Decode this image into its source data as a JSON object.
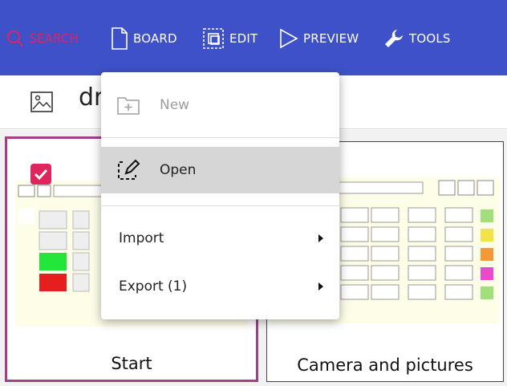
{
  "toolbar": {
    "search_label": "SEARCH",
    "board_label": "BOARD",
    "edit_label": "EDIT",
    "preview_label": "PREVIEW",
    "tools_label": "TOOLS",
    "colors": {
      "bar": "#3f51c8",
      "search": "#e0245e",
      "text": "#ffffff"
    }
  },
  "subbar": {
    "title_text": "dr",
    "image_icon": "image-icon"
  },
  "boards": [
    {
      "label": "Start",
      "selected": true
    },
    {
      "label": "Camera and pictures",
      "selected": false
    }
  ],
  "menu": {
    "items": [
      {
        "label": "New",
        "icon": "new-folder-icon",
        "enabled": false
      },
      {
        "label": "Open",
        "icon": "edit-open-icon",
        "enabled": true,
        "highlighted": true
      },
      {
        "label": "Import",
        "icon": "chevron-right-icon",
        "has_submenu": true
      },
      {
        "label": "Export (1)",
        "icon": "chevron-right-icon",
        "has_submenu": true
      }
    ]
  }
}
